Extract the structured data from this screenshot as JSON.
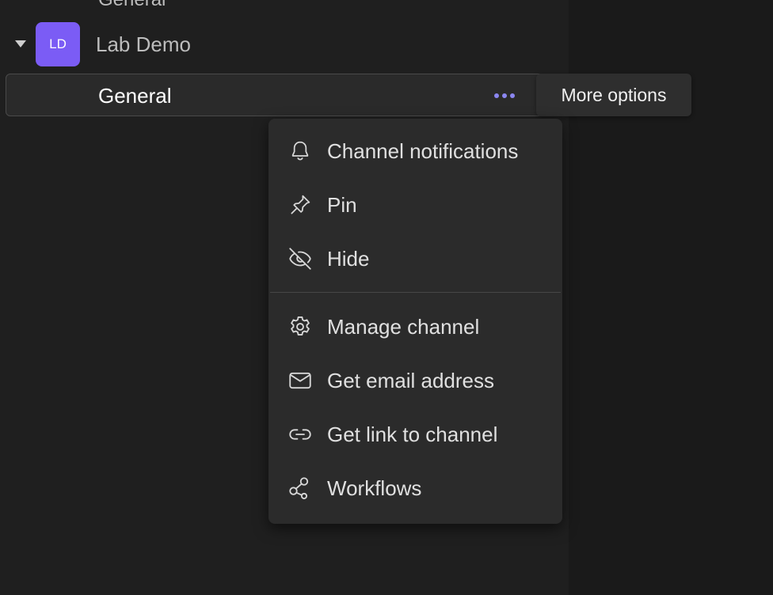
{
  "sidebar": {
    "previous_channel": "General",
    "team": {
      "initials": "LD",
      "name": "Lab Demo",
      "avatar_color": "#7b5cf5"
    },
    "selected_channel": {
      "name": "General",
      "more_icon": "ellipsis-icon",
      "accent": "#8b86f0"
    }
  },
  "tooltip": {
    "text": "More options"
  },
  "context_menu": {
    "group1": [
      {
        "label": "Channel notifications",
        "icon": "bell-icon"
      },
      {
        "label": "Pin",
        "icon": "pin-icon"
      },
      {
        "label": "Hide",
        "icon": "eye-off-icon"
      }
    ],
    "group2": [
      {
        "label": "Manage channel",
        "icon": "gear-icon"
      },
      {
        "label": "Get email address",
        "icon": "envelope-icon"
      },
      {
        "label": "Get link to channel",
        "icon": "link-icon"
      },
      {
        "label": "Workflows",
        "icon": "workflows-icon"
      }
    ]
  }
}
